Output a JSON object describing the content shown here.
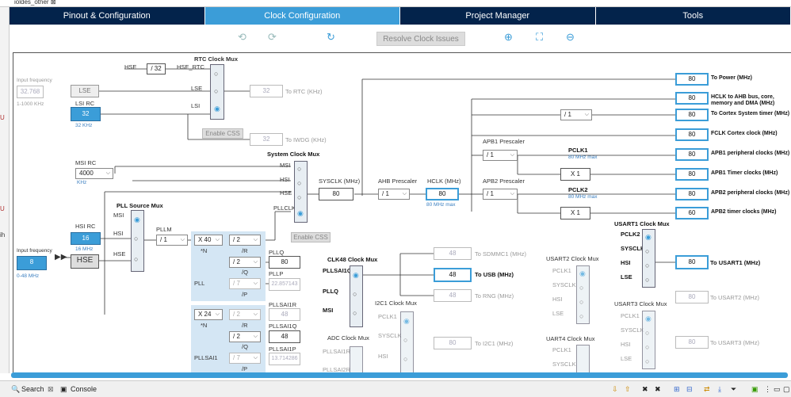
{
  "window": {
    "file_tab": "ioldes_other",
    "close": "⊠"
  },
  "tabs": [
    "Pinout & Configuration",
    "Clock Configuration",
    "Project Manager",
    "Tools"
  ],
  "toolbar": {
    "resolve_label": "Resolve Clock Issues"
  },
  "side_marks": [
    "U",
    "U",
    "ih"
  ],
  "status": {
    "search": "Search",
    "console": "Console"
  },
  "diagram": {
    "rtc_mux": "RTC Clock Mux",
    "input_freq": "Input frequency",
    "lse_freq": "32.768",
    "lse_range": "1-1000 KHz",
    "lse": "LSE",
    "lsi_rc": "LSI RC",
    "lsi_val": "32",
    "lsi_unit": "32 KHz",
    "hse_label": "HSE",
    "div32": "/ 32",
    "hse_rtc": "HSE_RTC",
    "lse_small": "LSE",
    "lsi_small": "LSI",
    "rtc_val": "32",
    "to_rtc": "To RTC (KHz)",
    "enable_css": "Enable CSS",
    "iwdg_val": "32",
    "to_iwdg": "To IWDG (KHz)",
    "msi_rc": "MSI RC",
    "msi_val": "4000",
    "khz": "KHz",
    "sys_mux": "System Clock Mux",
    "msi": "MSI",
    "hsi": "HSI",
    "hse": "HSE",
    "pllclk": "PLLCLK",
    "sysclk": "SYSCLK (MHz)",
    "sysclk_val": "80",
    "ahb_pre": "AHB Prescaler",
    "ahb_div": "/ 1",
    "hclk": "HCLK (MHz)",
    "hclk_val": "80",
    "hclk_max": "80 MHz max",
    "pll_src": "PLL Source Mux",
    "hsi_rc": "HSI RC",
    "hsi_val": "16",
    "hsi_unit": "16 MHz",
    "in_freq2": "Input frequency",
    "hse_val": "8",
    "hse_range": "0-48 MHz",
    "hse_box": "HSE",
    "pllm": "PLLM",
    "pllm_div": "/ 1",
    "pll_n": "X 40",
    "n_lbl": "*N",
    "r_div": "/ 2",
    "r_lbl": "/R",
    "q_div": "/ 2",
    "q_lbl": "/Q",
    "p_div": "/ 7",
    "p_lbl": "/P",
    "pllq": "PLLQ",
    "pllq_val": "80",
    "pllp": "PLLP",
    "pllp_val": "22.857143",
    "pll": "PLL",
    "enable_css2": "Enable CSS",
    "apb1_pre": "APB1 Prescaler",
    "apb1_div": "/ 1",
    "pclk1": "PCLK1",
    "pclk1_max": "80 MHz max",
    "x1a": "X 1",
    "apb2_pre": "APB2 Prescaler",
    "apb2_div": "/ 1",
    "pclk2": "PCLK2",
    "pclk2_max": "80 MHz max",
    "x1b": "X 1",
    "cortex_div": "/ 1",
    "outputs": [
      {
        "val": "80",
        "label": "To Power (MHz)"
      },
      {
        "val": "80",
        "label": "HCLK to AHB bus, core, memory and DMA (MHz)"
      },
      {
        "val": "80",
        "label": "To Cortex System timer (MHz)"
      },
      {
        "val": "80",
        "label": "FCLK Cortex clock (MHz)"
      },
      {
        "val": "80",
        "label": "APB1 peripheral clocks (MHz)"
      },
      {
        "val": "80",
        "label": "APB1 Timer clocks (MHz)"
      },
      {
        "val": "80",
        "label": "APB2 peripheral clocks (MHz)"
      },
      {
        "val": "60",
        "label": "APB2 timer clocks (MHz)"
      }
    ],
    "clk48_mux": "CLK48 Clock Mux",
    "pllsai1q": "PLLSAI1Q",
    "pllq2": "PLLQ",
    "msi2": "MSI",
    "sdmmc_val": "48",
    "to_sdmmc": "To SDMMC1 (MHz)",
    "usb_val": "48",
    "to_usb": "To USB (MHz)",
    "rng_val": "48",
    "to_rng": "To RNG (MHz)",
    "i2c1_mux": "I2C1 Clock Mux",
    "i2c_pclk1": "PCLK1",
    "i2c_sysclk": "SYSCLK",
    "i2c_hsi": "HSI",
    "i2c_val": "80",
    "to_i2c": "To I2C1 (MHz)",
    "adc_mux": "ADC Clock Mux",
    "adc_in1": "PLLSAI1R",
    "adc_in2": "PLLSAI2R",
    "pllsai_n": "X 24",
    "pllsai_nl": "*N",
    "sai_r": "/ 2",
    "sai_rl": "/R",
    "sai_q": "/ 2",
    "sai_ql": "/Q",
    "sai_p": "/ 7",
    "sai_pl": "/P",
    "sai1r": "PLLSAI1R",
    "sai1r_val": "48",
    "sai1q": "PLLSAI1Q",
    "sai1q_val": "48",
    "sai1p": "PLLSAI1P",
    "sai1p_val": "13.714286",
    "pllsai1": "PLLSAI1",
    "usart1_mux": "USART1 Clock Mux",
    "u1_pclk2": "PCLK2",
    "u1_sysclk": "SYSCLK",
    "u1_hsi": "HSI",
    "u1_lse": "LSE",
    "u1_val": "80",
    "to_u1": "To USART1 (MHz)",
    "usart2_mux": "USART2 Clock Mux",
    "u2_pclk1": "PCLK1",
    "u2_sysclk": "SYSCLK",
    "u2_hsi": "HSI",
    "u2_lse": "LSE",
    "u2_val": "80",
    "to_u2": "To USART2 (MHz)",
    "usart3_mux": "USART3 Clock Mux",
    "u3_pclk1": "PCLK1",
    "u3_sysclk": "SYSCLK",
    "u3_hsi": "HSI",
    "u3_lse": "LSE",
    "u3_val": "80",
    "to_u3": "To USART3 (MHz)",
    "uart4_mux": "UART4 Clock Mux",
    "u4_pclk1": "PCLK1",
    "u4_sysclk": "SYSCLK"
  }
}
